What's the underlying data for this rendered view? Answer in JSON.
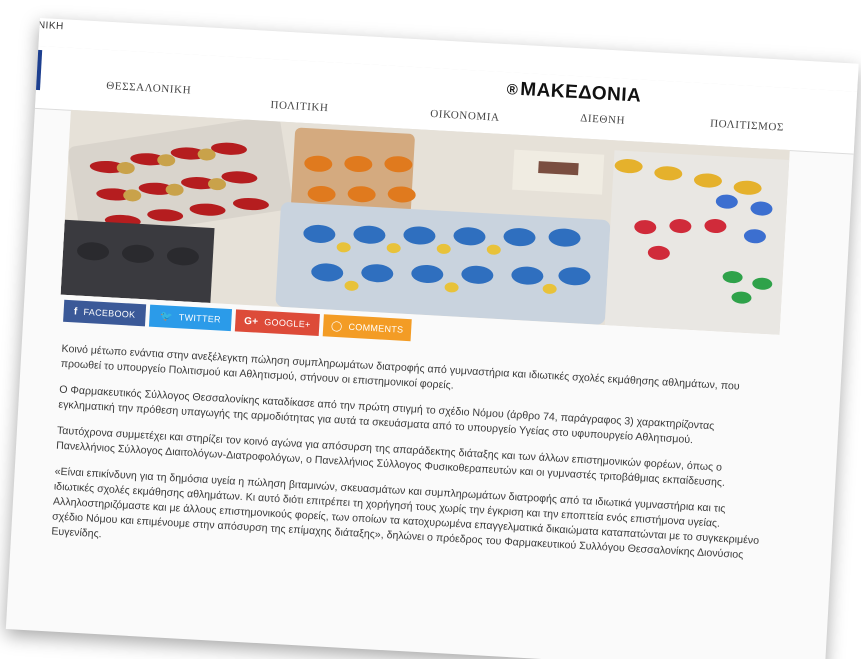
{
  "top_strip": {
    "city": "ΟΝΙΚΗ"
  },
  "header": {
    "logo_mark": "®",
    "logo": "ΜΑΚΕΔΟΝΙΑ",
    "nav": [
      {
        "label": "ΘΕΣΣΑΛΟΝΙΚΗ"
      },
      {
        "label": "ΠΟΛΙΤΙΚΗ"
      },
      {
        "label": "ΟΙΚΟΝΟΜΙΑ"
      },
      {
        "label": "ΔΙΕΘΝΗ"
      },
      {
        "label": "ΠΟΛΙΤΙΣΜΟΣ"
      }
    ]
  },
  "hero": {
    "icon": "pills-photo"
  },
  "share": {
    "facebook": {
      "icon": "f",
      "label": "FACEBOOK",
      "color": "#3b5998"
    },
    "twitter": {
      "icon": "🐦",
      "label": "TWITTER",
      "color": "#2b9be9"
    },
    "google": {
      "icon": "G+",
      "label": "GOOGLE+",
      "color": "#dd4b39"
    },
    "comments": {
      "icon": "◯",
      "label": "COMMENTS",
      "color": "#f39c25"
    }
  },
  "article": {
    "paragraphs": [
      "Κοινό μέτωπο ενάντια στην ανεξέλεγκτη πώληση συμπληρωμάτων διατροφής από γυμναστήρια και ιδιωτικές σχολές εκμάθησης αθλημάτων, που προωθεί το υπουργείο Πολιτισμού και Αθλητισμού, στήνουν οι επιστημονικοί φορείς.",
      "Ο Φαρμακευτικός Σύλλογος Θεσσαλονίκης καταδίκασε από την πρώτη στιγμή το σχέδιο Νόμου (άρθρο 74, παράγραφος 3) χαρακτηρίζοντας εγκληματική την πρόθεση υπαγωγής της αρμοδιότητας για αυτά τα σκευάσματα από το υπουργείο Υγείας στο υφυπουργείο Αθλητισμού.",
      "Ταυτόχρονα συμμετέχει και στηρίζει τον κοινό αγώνα για απόσυρση της απαράδεκτης διάταξης και των άλλων επιστημονικών φορέων, όπως ο Πανελλήνιος Σύλλογος Διαιτολόγων-Διατροφολόγων, ο Πανελλήνιος Σύλλογος Φυσικοθεραπευτών και οι γυμναστές τριτοβάθμιας εκπαίδευσης.",
      "«Είναι επικίνδυνη για τη δημόσια υγεία η πώληση βιταμινών, σκευασμάτων και συμπληρωμάτων διατροφής από τα ιδιωτικά γυμναστήρια και τις ιδιωτικές σχολές εκμάθησης αθλημάτων. Κι αυτό διότι επιτρέπει τη χορήγησή τους χωρίς την έγκριση και την εποπτεία ενός επιστήμονα υγείας. Αλληλοστηριζόμαστε και με άλλους επιστημονικούς φορείς, των οποίων τα κατοχυρωμένα επαγγελματικά δικαιώματα καταπατώνται με το συγκεκριμένο σχέδιο Νόμου και επιμένουμε στην απόσυρση της επίμαχης διάταξης», δηλώνει ο πρόεδρος του Φαρμακευτικού Συλλόγου Θεσσαλονίκης Διονύσιος Ευγενίδης."
    ]
  }
}
